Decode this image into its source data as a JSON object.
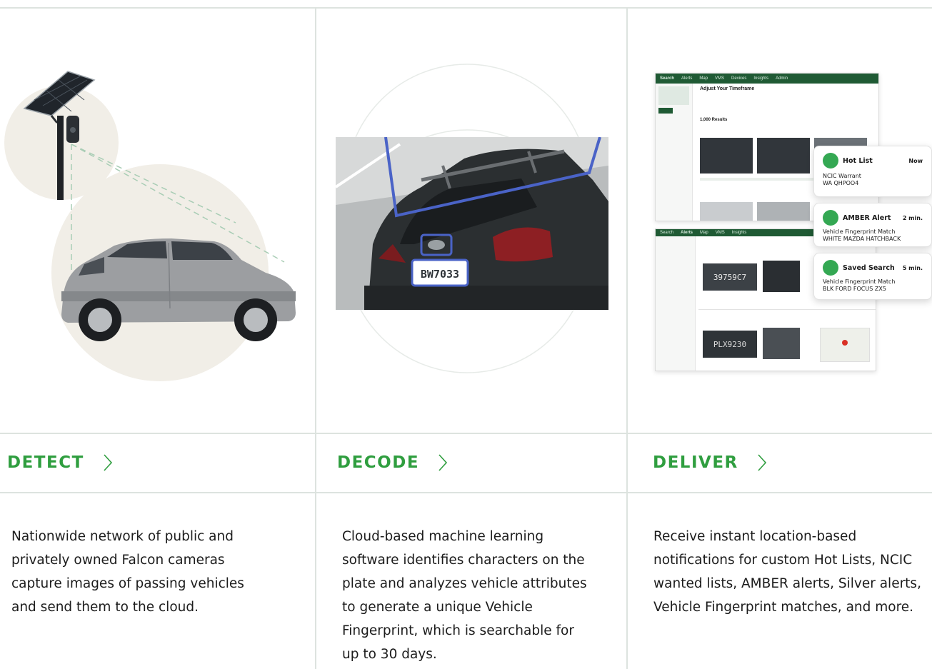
{
  "columns": [
    {
      "title": "DETECT",
      "description": "Nationwide network of public and privately owned Falcon cameras capture images of passing vehicles and send them to the cloud.",
      "lines": [
        "Nationwide network of public and",
        "privately owned Falcon cameras",
        "capture images of passing vehicles",
        "and send them to the cloud."
      ]
    },
    {
      "title": "DECODE",
      "description": "Cloud-based machine learning software identifies characters on the plate and analyzes vehicle attributes to generate a unique Vehicle Fingerprint, which is searchable for up to 30 days.",
      "lines": [
        "Cloud-based machine learning",
        "software identifies characters on the",
        "plate and analyzes vehicle attributes",
        "to generate a unique Vehicle",
        "Fingerprint, which is searchable for",
        "up to 30 days."
      ]
    },
    {
      "title": "DELIVER",
      "description": "Receive instant location-based notifications for custom Hot Lists, NCIC wanted lists, AMBER alerts, Silver alerts, Vehicle Fingerprint matches, and more.",
      "lines": [
        "Receive instant location-based",
        "notifications for custom Hot Lists, NCIC",
        "wanted lists, AMBER alerts, Silver alerts,",
        "Vehicle Fingerprint matches, and more."
      ]
    }
  ],
  "dashboard": {
    "nav": [
      "Search",
      "Alerts",
      "Map",
      "VMS",
      "Devices",
      "Insights",
      "Admin"
    ],
    "heading": "Adjust Your Timeframe",
    "results": "1,000 Results",
    "bottom_nav": [
      "Search",
      "Alerts",
      "Map",
      "VMS",
      "Insights"
    ],
    "plate_1": "39759C7",
    "plate_2": "PLX9230",
    "decode_plate": "BW7033"
  },
  "notifications": [
    {
      "title": "Hot List",
      "time": "Now",
      "line1": "NCIC Warrant",
      "line2": "WA QHPOO4"
    },
    {
      "title": "AMBER Alert",
      "time": "2 min.",
      "line1": "Vehicle Fingerprint Match",
      "line2": "WHITE MAZDA HATCHBACK"
    },
    {
      "title": "Saved Search",
      "time": "5 min.",
      "line1": "Vehicle Fingerprint Match",
      "line2": "BLK FORD FOCUS ZX5"
    }
  ],
  "colors": {
    "accent": "#2f9e3f",
    "dashboard_bar": "#1f5a34",
    "divider": "#dde3df",
    "beige": "#f1eee7"
  }
}
